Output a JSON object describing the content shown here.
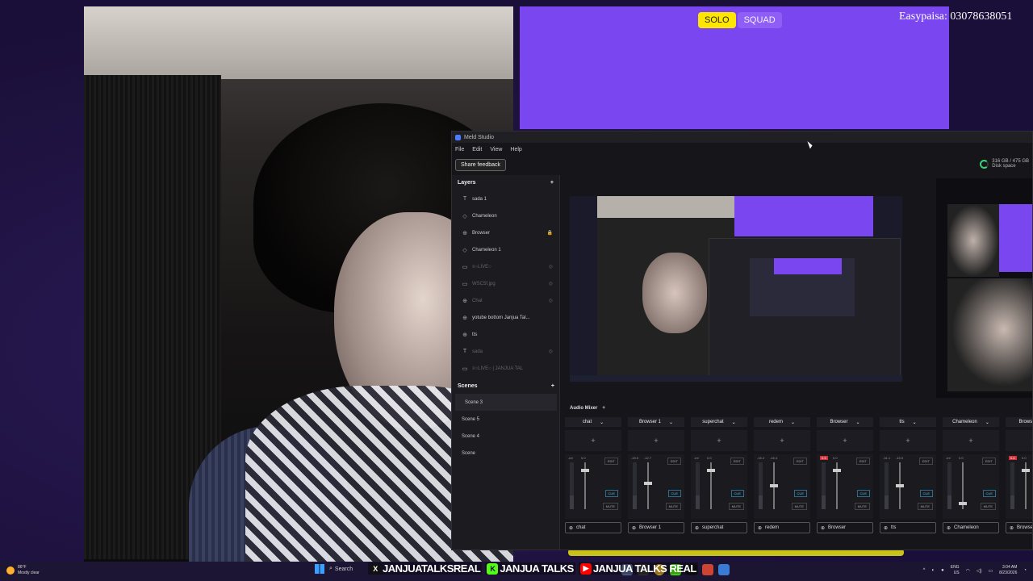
{
  "overlay": {
    "mode_solo": "SOLO",
    "mode_squad": "SQUAD",
    "donation": "Easypaisa: 03078638051"
  },
  "meld": {
    "title": "Meld Studio",
    "menu": [
      "File",
      "Edit",
      "View",
      "Help"
    ],
    "share_feedback": "Share feedback",
    "disk_size": "316 GB / 475 GB",
    "disk_label": "Disk space",
    "layers_title": "Layers",
    "layers": [
      {
        "icon": "T",
        "name": "sada 1",
        "dim": false,
        "badge": ""
      },
      {
        "icon": "◇",
        "name": "Chameleon",
        "dim": false,
        "badge": ""
      },
      {
        "icon": "⊕",
        "name": "Browser",
        "dim": false,
        "badge": "🔒"
      },
      {
        "icon": "◇",
        "name": "Chameleon 1",
        "dim": false,
        "badge": ""
      },
      {
        "icon": "▭",
        "name": "≡○LIVE○",
        "dim": true,
        "badge": "◎"
      },
      {
        "icon": "▭",
        "name": "WSC5f.jpg",
        "dim": true,
        "badge": "◎"
      },
      {
        "icon": "⊕",
        "name": "Chat",
        "dim": true,
        "badge": "◎"
      },
      {
        "icon": "⊕",
        "name": "yotube bottom Janjua Tal...",
        "dim": false,
        "badge": ""
      },
      {
        "icon": "⊕",
        "name": "tts",
        "dim": false,
        "badge": ""
      },
      {
        "icon": "T",
        "name": "sada",
        "dim": true,
        "badge": "◎"
      },
      {
        "icon": "▭",
        "name": "≡○LIVE○ | JANJUA TAL",
        "dim": true,
        "badge": ""
      }
    ],
    "scenes_title": "Scenes",
    "scenes": [
      "Scene 3",
      "Scene 5",
      "Scene 4",
      "Scene"
    ],
    "audio_mixer": "Audio Mixer",
    "edit": "EDIT",
    "cue": "CUE",
    "mute": "MUTE",
    "channels": [
      {
        "name": "chat",
        "peak": "-inf",
        "vol": "0.0",
        "level": 0.85,
        "peak_red": false
      },
      {
        "name": "Browser 1",
        "peak": "-19.0",
        "vol": "-12.7",
        "level": 0.55,
        "peak_red": false
      },
      {
        "name": "superchat",
        "peak": "-inf",
        "vol": "0.0",
        "level": 0.85,
        "peak_red": false
      },
      {
        "name": "redem",
        "peak": "-15.2",
        "vol": "-15.4",
        "level": 0.5,
        "peak_red": false
      },
      {
        "name": "Browser",
        "peak": "0.5",
        "vol": "0.0",
        "level": 0.85,
        "peak_red": true
      },
      {
        "name": "tts",
        "peak": "-31.1",
        "vol": "-15.0",
        "level": 0.5,
        "peak_red": false
      },
      {
        "name": "Chameleon",
        "peak": "-inf",
        "vol": "0.0",
        "level": 0.1,
        "peak_red": false
      },
      {
        "name": "Browser",
        "peak": "0.6",
        "vol": "0.0",
        "level": 0.85,
        "peak_red": true
      }
    ]
  },
  "taskbar": {
    "temp": "86°F",
    "weather": "Mostly clear",
    "search": "Search",
    "lang1": "ENG",
    "lang2": "US",
    "time": "3:04 AM",
    "date": "8/23/2026"
  },
  "socials": [
    {
      "icon": "x-icon",
      "glyph": "X",
      "text": "JANJUATALKSREAL"
    },
    {
      "icon": "kick-icon",
      "glyph": "K",
      "text": "JANJUA TALKS"
    },
    {
      "icon": "youtube-icon",
      "glyph": "▶",
      "text": "JANJUA TALKS REAL"
    }
  ]
}
